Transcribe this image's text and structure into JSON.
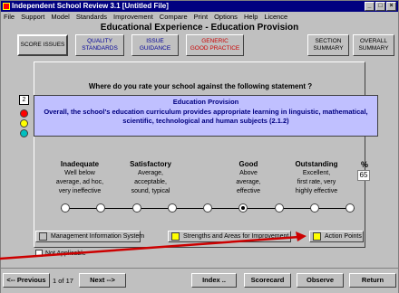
{
  "window": {
    "title": "Independent School Review 3.1 [Untitled File]",
    "controls": [
      "_",
      "□",
      "×"
    ]
  },
  "menu": [
    "File",
    "Support",
    "Model",
    "Standards",
    "Improvement",
    "Compare",
    "Print",
    "Options",
    "Help",
    "Licence"
  ],
  "header": {
    "title": "Educational Experience - Education Provision"
  },
  "tabs": {
    "score_issues": "SCORE ISSUES",
    "quality_standards": [
      "QUALITY",
      "STANDARDS"
    ],
    "issue_guidance": [
      "ISSUE",
      "GUIDANCE"
    ],
    "generic_good_practice": [
      "GENERIC",
      "GOOD PRACTICE"
    ],
    "section_summary": [
      "SECTION",
      "SUMMARY"
    ],
    "overall_summary": [
      "OVERALL",
      "SUMMARY"
    ]
  },
  "panel": {
    "question": "Where do you rate your school against the following statement ?",
    "issue_number": "2",
    "statement_title": "Education Provision",
    "statement_text": "Overall, the school's education curriculum provides appropriate learning in linguistic, mathematical, scientific, technological and human subjects (2.1.2)",
    "lights": [
      "#ff0000",
      "#ffff00",
      "#00c0c0"
    ]
  },
  "ratings": [
    {
      "title": "Inadequate",
      "desc": [
        "Well below",
        "average, ad hoc,",
        "very ineffective"
      ]
    },
    {
      "title": "Satisfactory",
      "desc": [
        "Average,",
        "acceptable,",
        "sound, typical"
      ]
    },
    {
      "title": "Good",
      "desc": [
        "Above",
        "average,",
        "effective"
      ]
    },
    {
      "title": "Outstanding",
      "desc": [
        "Excellent,",
        "first rate, very",
        "highly effective"
      ]
    }
  ],
  "percent": {
    "label": "%",
    "value": "65"
  },
  "slider": {
    "positions": 9,
    "selected_index": 5
  },
  "buttons": {
    "mis": "Management Information System",
    "strengths": "Strengths and Areas for Improvement",
    "action_points": "Action Points"
  },
  "not_applicable": "Not Applicable",
  "footer": {
    "previous": "<-- Previous",
    "page": "1 of 17",
    "next": "Next -->",
    "index": "Index ..",
    "scorecard": "Scorecard",
    "observe": "Observe",
    "return": "Return"
  },
  "colors": {
    "titlebar": "#000080",
    "statement_bg": "#c0c0ff",
    "swatch_yellow": "#ffff00",
    "arrow": "#cc0000"
  }
}
